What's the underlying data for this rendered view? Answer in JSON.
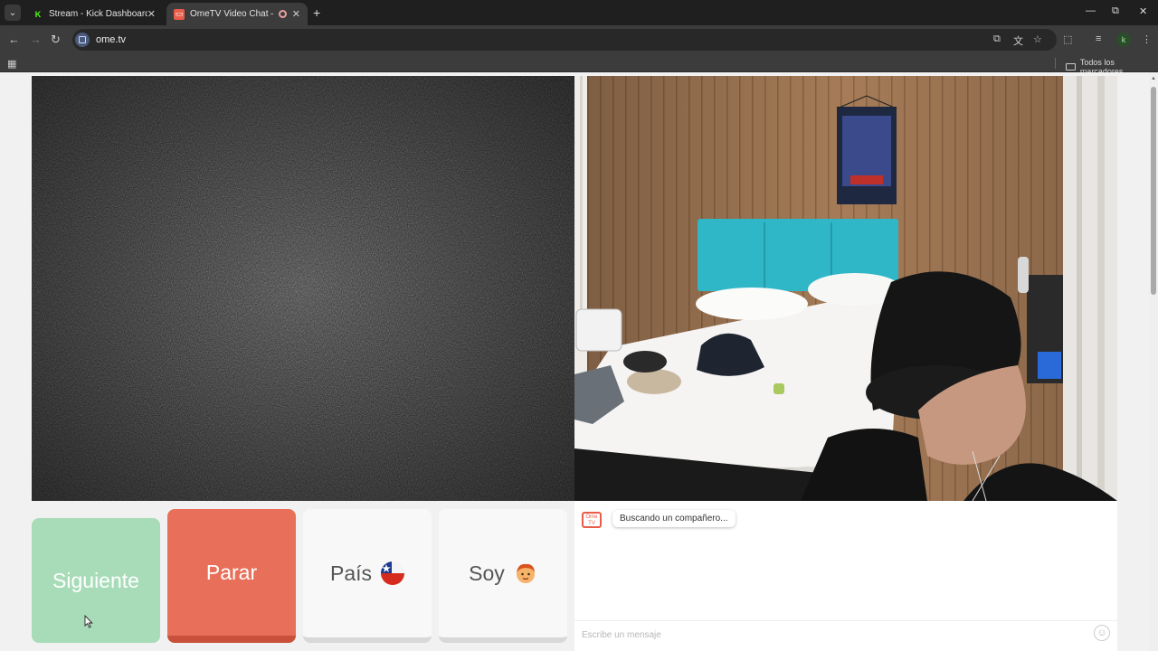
{
  "browser": {
    "tabs": [
      {
        "title": "Stream - Kick Dashboard",
        "close": "✕"
      },
      {
        "title": "OmeTV Video Chat — Ome",
        "close": "✕"
      }
    ],
    "new_tab": "+",
    "window": {
      "minimize": "—",
      "restore": "⧉",
      "close": "✕"
    },
    "nav": {
      "back": "←",
      "forward": "→",
      "reload": "↻"
    },
    "url": "ome.tv",
    "profile_initial": "k",
    "bookmarks_folder": "Todos los marcadores"
  },
  "controls": {
    "next_label": "Siguiente",
    "stop_label": "Parar",
    "country_label": "País",
    "gender_label": "Soy"
  },
  "chat": {
    "logo_text": "Ome TV",
    "status_message": "Buscando un compañero...",
    "input_placeholder": "Escribe un mensaje"
  },
  "colors": {
    "next": "#a8dcb8",
    "stop": "#e8705a",
    "brand": "#e85d4a"
  }
}
